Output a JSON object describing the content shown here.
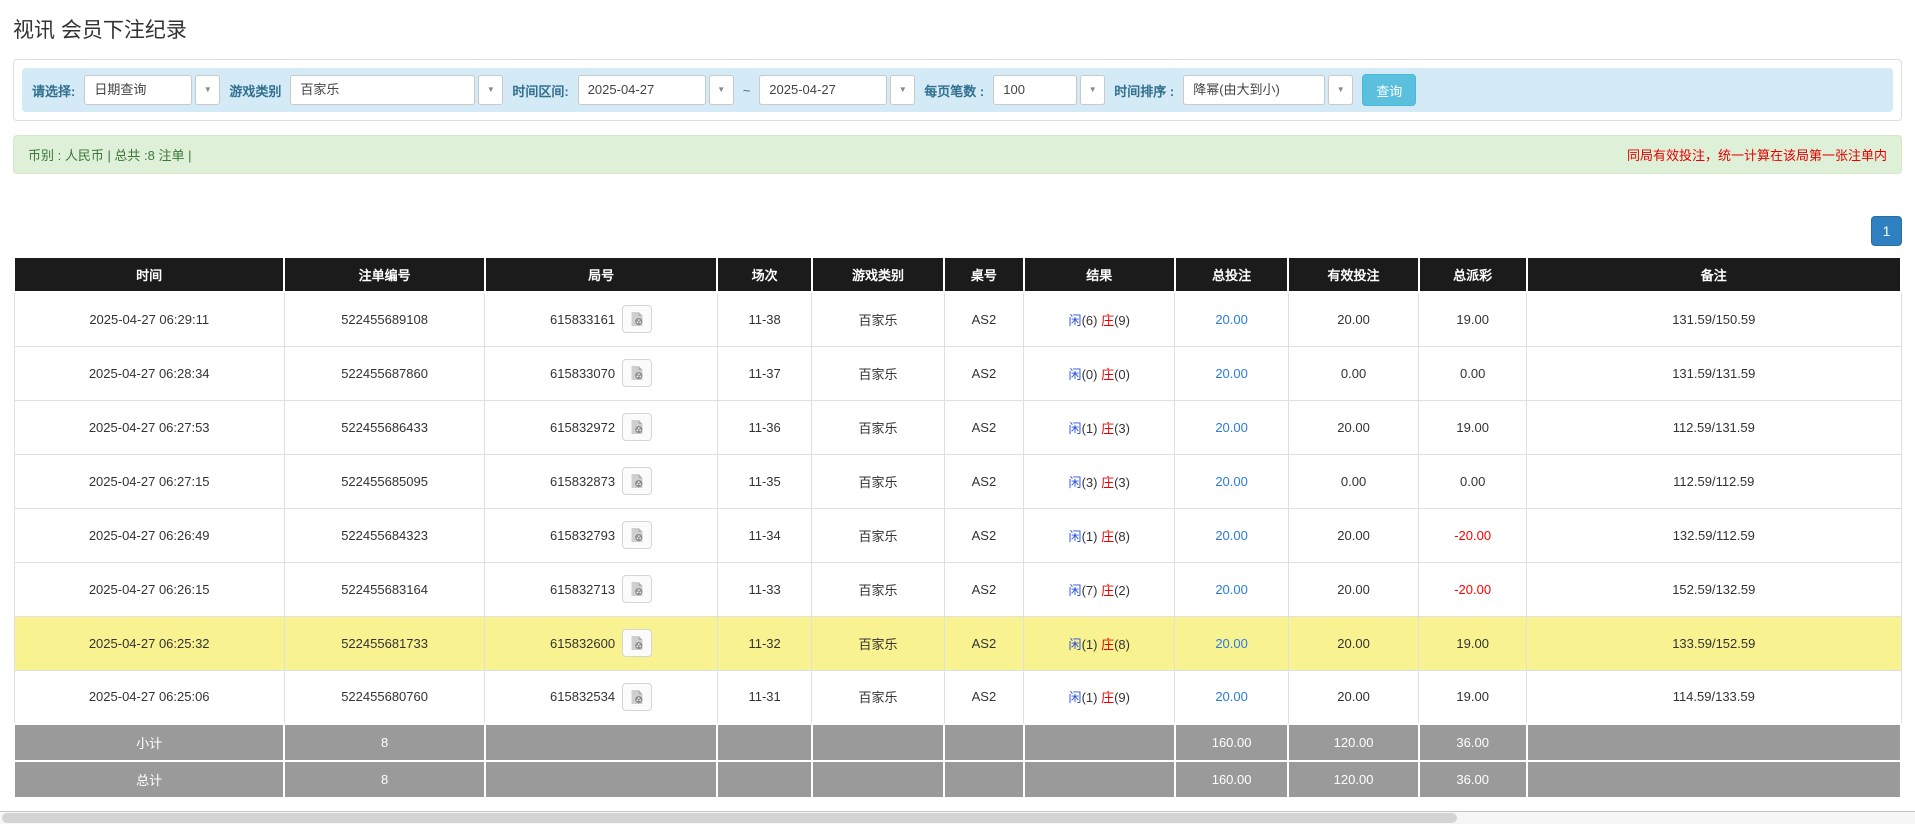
{
  "page": {
    "title": "视讯 会员下注纪录"
  },
  "icons": {
    "dropdown_caret": "▼",
    "video_icon": "film-document-icon"
  },
  "filters": {
    "query_type": {
      "label": "请选择:",
      "value": "日期查询"
    },
    "game_category": {
      "label": "游戏类别",
      "value": "百家乐"
    },
    "time_range": {
      "label": "时间区间:",
      "from": "2025-04-27",
      "separator": "~",
      "to": "2025-04-27"
    },
    "page_size": {
      "label": "每页笔数 :",
      "value": "100"
    },
    "time_sort": {
      "label": "时间排序 :",
      "value": "降幂(由大到小)"
    },
    "search_button": "查询"
  },
  "summary_bar": {
    "left": "币别 : 人民币 | 总共 :8 注单 |",
    "right": "同局有效投注，统一计算在该局第一张注单内"
  },
  "pagination": {
    "current_page": "1"
  },
  "colors": {
    "header_bg": "#1b1b1b",
    "footer_bg": "#9a9a9a",
    "highlight_row": "#f9f291",
    "filter_bar_bg": "#d4eaf6",
    "alert_bg": "#dff0d8",
    "alert_text": "#3c763d",
    "alert_note": "#e60000",
    "link_blue": "#2a7ce0",
    "xian_blue": "#2b50e0",
    "zhuang_red": "#e60000",
    "negative_red": "#ff0000",
    "search_btn": "#5bc0de",
    "page_btn": "#2e80c1"
  },
  "table": {
    "columns": [
      "时间",
      "注单编号",
      "局号",
      "场次",
      "游戏类别",
      "桌号",
      "结果",
      "总投注",
      "有效投注",
      "总派彩",
      "备注"
    ],
    "rows": [
      {
        "time": "2025-04-27 06:29:11",
        "bet_id": "522455689108",
        "round_id": "615833161",
        "session": "11-38",
        "game": "百家乐",
        "table_no": "AS2",
        "result": {
          "xian_label": "闲",
          "xian_value": "(6)",
          "zhuang_label": "庄",
          "zhuang_value": "(9)"
        },
        "total_bet": "20.00",
        "valid_bet": "20.00",
        "payout": "19.00",
        "remark": "131.59/150.59",
        "highlight": false
      },
      {
        "time": "2025-04-27 06:28:34",
        "bet_id": "522455687860",
        "round_id": "615833070",
        "session": "11-37",
        "game": "百家乐",
        "table_no": "AS2",
        "result": {
          "xian_label": "闲",
          "xian_value": "(0)",
          "zhuang_label": "庄",
          "zhuang_value": "(0)"
        },
        "total_bet": "20.00",
        "valid_bet": "0.00",
        "payout": "0.00",
        "remark": "131.59/131.59",
        "highlight": false
      },
      {
        "time": "2025-04-27 06:27:53",
        "bet_id": "522455686433",
        "round_id": "615832972",
        "session": "11-36",
        "game": "百家乐",
        "table_no": "AS2",
        "result": {
          "xian_label": "闲",
          "xian_value": "(1)",
          "zhuang_label": "庄",
          "zhuang_value": "(3)"
        },
        "total_bet": "20.00",
        "valid_bet": "20.00",
        "payout": "19.00",
        "remark": "112.59/131.59",
        "highlight": false
      },
      {
        "time": "2025-04-27 06:27:15",
        "bet_id": "522455685095",
        "round_id": "615832873",
        "session": "11-35",
        "game": "百家乐",
        "table_no": "AS2",
        "result": {
          "xian_label": "闲",
          "xian_value": "(3)",
          "zhuang_label": "庄",
          "zhuang_value": "(3)"
        },
        "total_bet": "20.00",
        "valid_bet": "0.00",
        "payout": "0.00",
        "remark": "112.59/112.59",
        "highlight": false
      },
      {
        "time": "2025-04-27 06:26:49",
        "bet_id": "522455684323",
        "round_id": "615832793",
        "session": "11-34",
        "game": "百家乐",
        "table_no": "AS2",
        "result": {
          "xian_label": "闲",
          "xian_value": "(1)",
          "zhuang_label": "庄",
          "zhuang_value": "(8)"
        },
        "total_bet": "20.00",
        "valid_bet": "20.00",
        "payout": "-20.00",
        "remark": "132.59/112.59",
        "highlight": false
      },
      {
        "time": "2025-04-27 06:26:15",
        "bet_id": "522455683164",
        "round_id": "615832713",
        "session": "11-33",
        "game": "百家乐",
        "table_no": "AS2",
        "result": {
          "xian_label": "闲",
          "xian_value": "(7)",
          "zhuang_label": "庄",
          "zhuang_value": "(2)"
        },
        "total_bet": "20.00",
        "valid_bet": "20.00",
        "payout": "-20.00",
        "remark": "152.59/132.59",
        "highlight": false
      },
      {
        "time": "2025-04-27 06:25:32",
        "bet_id": "522455681733",
        "round_id": "615832600",
        "session": "11-32",
        "game": "百家乐",
        "table_no": "AS2",
        "result": {
          "xian_label": "闲",
          "xian_value": "(1)",
          "zhuang_label": "庄",
          "zhuang_value": "(8)"
        },
        "total_bet": "20.00",
        "valid_bet": "20.00",
        "payout": "19.00",
        "remark": "133.59/152.59",
        "highlight": true
      },
      {
        "time": "2025-04-27 06:25:06",
        "bet_id": "522455680760",
        "round_id": "615832534",
        "session": "11-31",
        "game": "百家乐",
        "table_no": "AS2",
        "result": {
          "xian_label": "闲",
          "xian_value": "(1)",
          "zhuang_label": "庄",
          "zhuang_value": "(9)"
        },
        "total_bet": "20.00",
        "valid_bet": "20.00",
        "payout": "19.00",
        "remark": "114.59/133.59",
        "highlight": false
      }
    ],
    "subtotal": {
      "label": "小计",
      "count": "8",
      "total_bet": "160.00",
      "valid_bet": "120.00",
      "payout": "36.00"
    },
    "total": {
      "label": "总计",
      "count": "8",
      "total_bet": "160.00",
      "valid_bet": "120.00",
      "payout": "36.00"
    }
  }
}
